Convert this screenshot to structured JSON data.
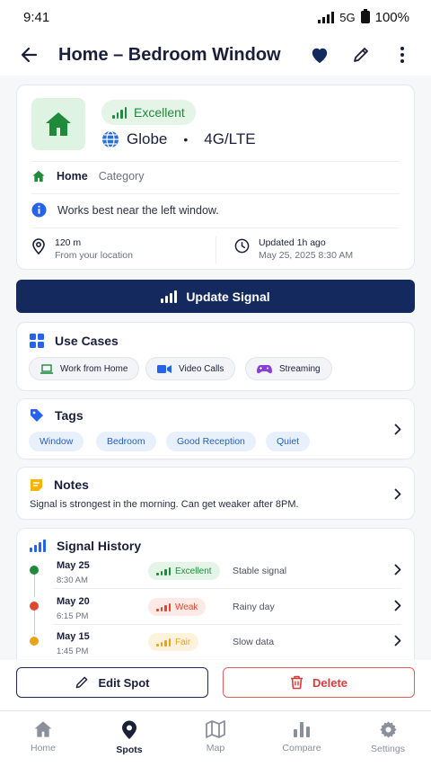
{
  "status_bar": {
    "time": "9:41",
    "network": "5G",
    "battery": "100%"
  },
  "header": {
    "title": "Home – Bedroom Window"
  },
  "spot": {
    "quality": "Excellent",
    "carrier": "Globe",
    "separator": "•",
    "network_type": "4G/LTE",
    "category_name": "Home",
    "category_label": "Category",
    "note_hint": "Works best near the left window.",
    "distance": "120 m",
    "distance_label": "From your location",
    "updated": "Updated 1h ago",
    "updated_date": "May 25, 2025 8:30 AM"
  },
  "update_button": {
    "label": "Update Signal"
  },
  "use_cases": {
    "title": "Use Cases",
    "items": [
      {
        "label": "Work from Home",
        "icon": "laptop-icon"
      },
      {
        "label": "Video Calls",
        "icon": "video-camera-icon"
      },
      {
        "label": "Streaming",
        "icon": "gamepad-icon"
      }
    ]
  },
  "tags": {
    "title": "Tags",
    "items": [
      "Window",
      "Bedroom",
      "Good Reception",
      "Quiet"
    ]
  },
  "notes": {
    "title": "Notes",
    "text": "Signal is strongest in the morning. Can get weaker after 8PM."
  },
  "signal_history": {
    "title": "Signal History",
    "entries": [
      {
        "date": "May 25",
        "time": "8:30 AM",
        "quality": "Excellent",
        "note": "Stable signal",
        "color": "#1f8a3a",
        "bg": "#e4f4e7"
      },
      {
        "date": "May 20",
        "time": "6:15 PM",
        "quality": "Weak",
        "note": "Rainy day",
        "color": "#e0472d",
        "bg": "#fde9e5"
      },
      {
        "date": "May 15",
        "time": "1:45 PM",
        "quality": "Fair",
        "note": "Slow data",
        "color": "#e8a317",
        "bg": "#fdf3dc"
      }
    ]
  },
  "actions": {
    "edit": "Edit Spot",
    "delete": "Delete"
  },
  "nav": {
    "items": [
      {
        "label": "Home",
        "icon": "house-icon"
      },
      {
        "label": "Spots",
        "icon": "map-pin-icon"
      },
      {
        "label": "Map",
        "icon": "folded-map-icon"
      },
      {
        "label": "Compare",
        "icon": "bar-chart-icon"
      },
      {
        "label": "Settings",
        "icon": "gear-icon"
      }
    ],
    "active": "Spots"
  },
  "colors": {
    "primary": "#142a5e",
    "success": "#1f8a3a",
    "danger": "#d63c3c",
    "warning": "#e8a317",
    "info": "#2563eb"
  }
}
